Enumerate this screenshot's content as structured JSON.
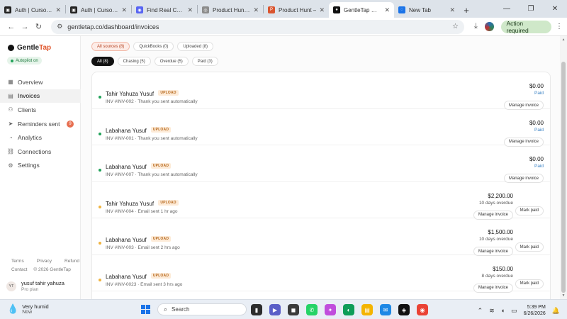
{
  "browser": {
    "tabs": [
      {
        "title": "Auth | Cursor - T",
        "color": "#222222",
        "glyph": "▣"
      },
      {
        "title": "Auth | Cursor - T",
        "color": "#222222",
        "glyph": "▣"
      },
      {
        "title": "Find Real Custo",
        "color": "#5865f2",
        "glyph": "◉"
      },
      {
        "title": "Product Hunt Co",
        "color": "#8c8c8c",
        "glyph": "◎"
      },
      {
        "title": "Product Hunt – ",
        "color": "#da552f",
        "glyph": "P"
      },
      {
        "title": "GentleTap — AI",
        "color": "#111111",
        "glyph": "●",
        "active": true
      },
      {
        "title": "New Tab",
        "color": "#1a73e8",
        "glyph": "◌"
      }
    ],
    "url": "gentletap.co/dashboard/invoices",
    "action_required": "Action required"
  },
  "sidebar": {
    "brand_gentle": "Gentle",
    "brand_tap": "Tap",
    "autopilot": "Autopilot on",
    "items": [
      {
        "label": "Overview",
        "icon": "grid-icon"
      },
      {
        "label": "Invoices",
        "icon": "document-icon",
        "active": true
      },
      {
        "label": "Clients",
        "icon": "people-icon"
      },
      {
        "label": "Reminders sent",
        "icon": "send-icon",
        "badge": "9"
      },
      {
        "label": "Analytics",
        "icon": "chart-icon"
      },
      {
        "label": "Connections",
        "icon": "link-icon"
      },
      {
        "label": "Settings",
        "icon": "gear-icon"
      }
    ],
    "footer": {
      "terms": "Terms",
      "privacy": "Privacy",
      "refund": "Refund",
      "contact": "Contact",
      "copyright": "© 2026 GentleTap"
    },
    "user": {
      "initials": "YT",
      "name": "yusuf tahir yahuza",
      "plan": "Pro plan"
    }
  },
  "filters": {
    "sources": [
      "All sources (8)",
      "QuickBooks (0)",
      "Uploaded (8)"
    ],
    "statuses": [
      "All (8)",
      "Chasing (5)",
      "Overdue (5)",
      "Paid (3)"
    ]
  },
  "invoices": [
    {
      "name": "Tahir Yahuza Yusuf",
      "tag": "UPLOAD",
      "detail": "INV #INV-002 · Thank you sent automatically",
      "amount": "$0.00",
      "status": "Paid",
      "status_color": "#3b82c4",
      "dot": "#22a35a",
      "button": "Manage invoice"
    },
    {
      "name": "Labahana Yusuf",
      "tag": "UPLOAD",
      "detail": "INV #INV-001 · Thank you sent automatically",
      "amount": "$0.00",
      "status": "Paid",
      "status_color": "#3b82c4",
      "dot": "#22a35a",
      "button": "Manage invoice"
    },
    {
      "name": "Labahana Yusuf",
      "tag": "UPLOAD",
      "detail": "INV #INV-007 · Thank you sent automatically",
      "amount": "$0.00",
      "status": "Paid",
      "status_color": "#3b82c4",
      "dot": "#22a35a",
      "button": "Manage invoice"
    },
    {
      "name": "Tahir Yahuza Yusuf",
      "tag": "UPLOAD",
      "detail": "INV #INV-004 · Email sent 1 hr ago",
      "amount": "$2,200.00",
      "status": "10 days overdue",
      "status_color": "#555555",
      "dot": "#f0b440",
      "button": "Manage invoice",
      "secondary": "Mark paid"
    },
    {
      "name": "Labahana Yusuf",
      "tag": "UPLOAD",
      "detail": "INV #INV-003 · Email sent 2 hrs ago",
      "amount": "$1,500.00",
      "status": "10 days overdue",
      "status_color": "#555555",
      "dot": "#f0b440",
      "button": "Manage invoice",
      "secondary": "Mark paid"
    },
    {
      "name": "Labahana Yusuf",
      "tag": "UPLOAD",
      "detail": "INV #INV-0023 · Email sent 3 hrs ago",
      "amount": "$150.00",
      "status": "8 days overdue",
      "status_color": "#555555",
      "dot": "#f0b440",
      "button": "Manage invoice",
      "secondary": "Mark paid"
    }
  ],
  "taskbar": {
    "weather_title": "Very humid",
    "weather_sub": "Now",
    "search": "Search",
    "time": "5:39 PM",
    "date": "6/26/2026"
  }
}
